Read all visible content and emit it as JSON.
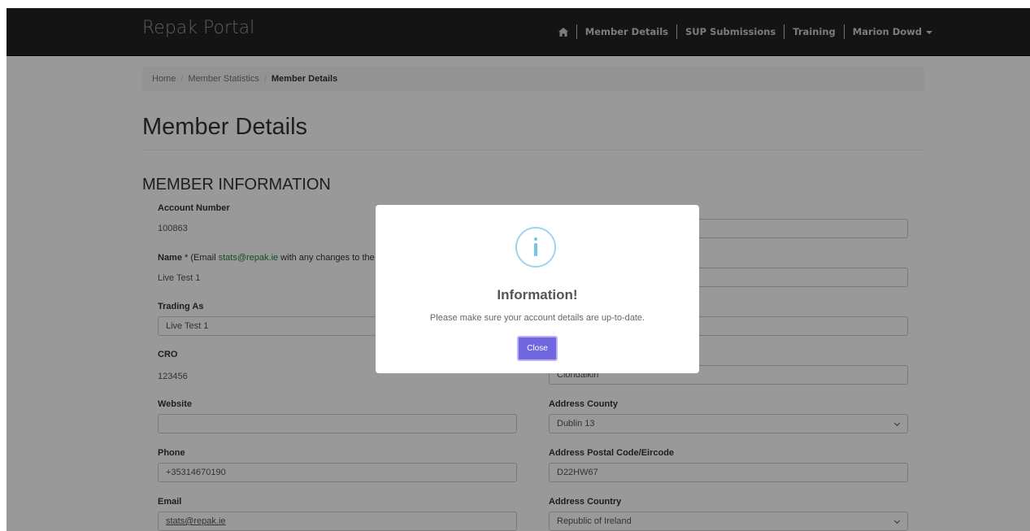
{
  "app": {
    "brand": "Repak Portal"
  },
  "nav": {
    "items": [
      "Member Details",
      "SUP Submissions",
      "Training"
    ],
    "user": "Marion Dowd"
  },
  "breadcrumb": {
    "home": "Home",
    "stats": "Member Statistics",
    "current": "Member Details"
  },
  "page": {
    "title": "Member Details",
    "section": "MEMBER INFORMATION"
  },
  "left": {
    "account_label": "Account Number",
    "account_value": "100863",
    "name_label": "Name",
    "name_note_pre": " * (Email ",
    "name_email": "stats@repak.ie",
    "name_note_post": " with any changes to the m",
    "name_value": "Live Test 1",
    "trading_label": "Trading As",
    "trading_value": "Live Test 1",
    "cro_label": "CRO",
    "cro_value": "123456",
    "website_label": "Website",
    "website_value": "",
    "phone_label": "Phone",
    "phone_value": "+35314670190",
    "email_label": "Email",
    "email_value": "stats@repak.ie"
  },
  "right": {
    "field1_value": "",
    "field2_value": "",
    "field3_value": "",
    "city_value": "Clondalkin",
    "county_label": "Address County",
    "county_value": "Dublin 13",
    "postal_label": "Address Postal Code/Eircode",
    "postal_value": "D22HW67",
    "country_label": "Address Country",
    "country_value": "Republic of Ireland"
  },
  "modal": {
    "title": "Information!",
    "message": "Please make sure your account details are up-to-date.",
    "button": "Close",
    "accent": "#7066e0",
    "icon_color": "#9ad6ef"
  }
}
